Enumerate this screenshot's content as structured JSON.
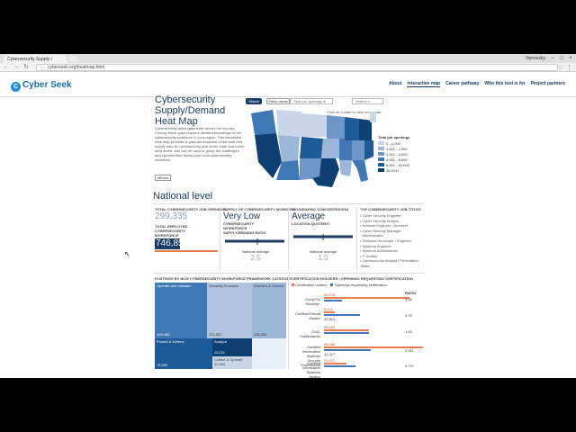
{
  "browser": {
    "tab_title": "Cybersecurity Supply /",
    "window_user": "Tarnovsky",
    "url": "cyberseek.org/heatmap.html"
  },
  "site": {
    "logo": "Cyber Seek",
    "nav": [
      "About",
      "Interactive map",
      "Career pathway",
      "Who this tool is for",
      "Project partners"
    ]
  },
  "intro": {
    "title": "Cybersecurity Supply/Demand Heat Map",
    "text": "Cybersecurity talent gaps exist across the country. Closing these gaps requires detailed knowledge of the cybersecurity workforce in your region. This interactive heat map provides a granular snapshot of demand and supply data for cybersecurity jobs at the state and metro area levels, and can be used to grasp the challenges and opportunities facing your local cybersecurity workforce.",
    "share": "Share"
  },
  "controls": {
    "states": "States",
    "metro": "Metro areas",
    "job_dropdown": "Total job openings",
    "search": "Search",
    "map_hint": "Click on a state to view more data"
  },
  "legend": {
    "title": "Total job openings",
    "items": [
      "0 - 1,000",
      "1,001 - 2,000",
      "2,001 - 4,000",
      "4,001 - 8,000",
      "8,001 - 16,000",
      "16,001+"
    ],
    "colors": [
      "#c9d6ea",
      "#9db7db",
      "#6e97c8",
      "#3f78b5",
      "#1d5a98",
      "#0d3f73"
    ]
  },
  "national": {
    "heading": "National level",
    "openings_title": "Total cybersecurity job openings",
    "openings_value": "299,335",
    "employed_title": "Total employed cybersecurity workforce",
    "employed_value": "746,858",
    "supply_title": "Supply of cybersecurity workers",
    "supply_value": "Very Low",
    "supply_ratio_title": "Cybersecurity workforce supply/demand ratio",
    "supply_ratio_label": "National average",
    "supply_ratio_value": "2.5",
    "geo_title": "Geographic concentration",
    "geo_value": "Average",
    "geo_sub": "Location quotient",
    "geo_avg_label": "National average",
    "geo_avg_value": "1.0",
    "top_titles_title": "Top cybersecurity job titles",
    "top_titles": [
      "Cyber Security Engineer",
      "Cyber Security Analyst",
      "Network Engineer / Architect",
      "Cyber Security Manager",
      "Administrator",
      "Software Developer / Engineer",
      "Systems Engineer",
      "Systems Administrator",
      "IT Auditor",
      "Cybersecurity Analyst / Penetration Tester"
    ]
  },
  "postings": {
    "title": "Postings by NICE cybersecurity workforce framework category",
    "cells": [
      {
        "label": "Operate and Maintain",
        "value": "104,366"
      },
      {
        "label": "Securely Provision",
        "value": "101,587"
      },
      {
        "label": "Oversee & Govern",
        "value": "118,354"
      },
      {
        "label": "Protect & Defend",
        "value": "78,590"
      },
      {
        "label": "Analyze",
        "value": "25,211"
      },
      {
        "label": "Collect & Operate",
        "value": "12,954"
      },
      {
        "label": "Investigate",
        "value": ""
      }
    ]
  },
  "certs": {
    "title": "Certification holders / openings requesting certification",
    "legend_a": "Certification holders",
    "legend_b": "Openings requesting certification",
    "ratio_header": "RATIO",
    "rows": [
      {
        "name": "CompTIA Security+",
        "holders": "63,278",
        "openings": "",
        "ratio": "3.08"
      },
      {
        "name": "Certified Ethical Hacker",
        "holders": "9,011",
        "openings": "32,821",
        "ratio": "3.76"
      },
      {
        "name": "GIAC Certifications",
        "holders": "39,403",
        "openings": "",
        "ratio": "1.00"
      },
      {
        "name": "Certified Information Systems Security Professional",
        "holders": "88,068",
        "openings": "41,317",
        "ratio": "0.911"
      },
      {
        "name": "Certified Information Systems Auditor",
        "holders": "20,012",
        "openings": "",
        "ratio": "0.727"
      }
    ]
  }
}
